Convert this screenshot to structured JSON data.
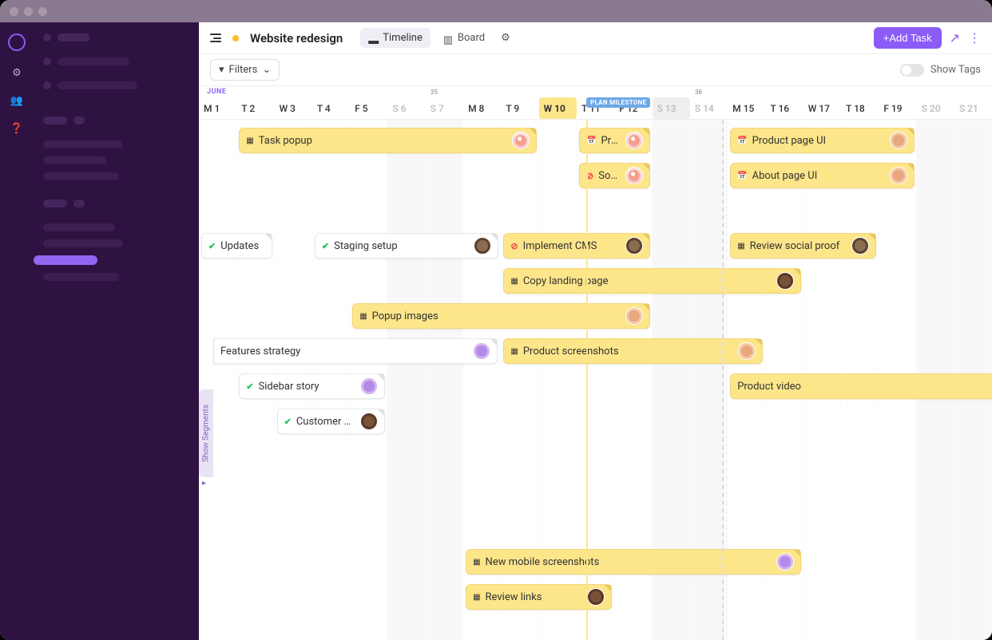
{
  "project": {
    "name": "Website redesign"
  },
  "views": {
    "timeline": "Timeline",
    "board": "Board"
  },
  "actions": {
    "add_task": "+Add Task",
    "filters": "Filters",
    "show_tags": "Show Tags"
  },
  "month": "JUNE",
  "milestone_label": "PLAN MILESTONE",
  "segments_label": "Show Segments",
  "days": [
    {
      "l": "M 1"
    },
    {
      "l": "T 2"
    },
    {
      "l": "W 3"
    },
    {
      "l": "T 4"
    },
    {
      "l": "F 5"
    },
    {
      "l": "S 6",
      "w": true
    },
    {
      "l": "S 7",
      "w": true,
      "wk": "35"
    },
    {
      "l": "M 8"
    },
    {
      "l": "T 9"
    },
    {
      "l": "W 10",
      "today": true
    },
    {
      "l": "T 11"
    },
    {
      "l": "F 12"
    },
    {
      "l": "S 13",
      "w": true,
      "gray": true
    },
    {
      "l": "S 14",
      "w": true,
      "wk": "36"
    },
    {
      "l": "M 15"
    },
    {
      "l": "T 16"
    },
    {
      "l": "W 17"
    },
    {
      "l": "T 18"
    },
    {
      "l": "F 19"
    },
    {
      "l": "S 20",
      "w": true
    },
    {
      "l": "S 21",
      "w": true
    }
  ],
  "tasks": [
    {
      "name": "Task popup",
      "row": 0,
      "start": 1,
      "span": 8,
      "style": "yellow",
      "icon": "progress",
      "av": "av1"
    },
    {
      "name": "Product",
      "row": 0,
      "start": 10,
      "span": 2,
      "style": "yellow",
      "icon": "cal",
      "av": "av1"
    },
    {
      "name": "Product page UI",
      "row": 0,
      "start": 14,
      "span": 5,
      "style": "yellow",
      "icon": "cal",
      "av": "av3"
    },
    {
      "name": "Social",
      "row": 1,
      "start": 10,
      "span": 2,
      "style": "yellow",
      "icon": "block",
      "av": "av1"
    },
    {
      "name": "About page UI",
      "row": 1,
      "start": 14,
      "span": 5,
      "style": "yellow",
      "icon": "cal",
      "av": "av3"
    },
    {
      "name": "Updates",
      "row": 3,
      "start": 0,
      "span": 2,
      "style": "white",
      "icon": "check"
    },
    {
      "name": "Staging setup",
      "row": 3,
      "start": 3,
      "span": 5,
      "style": "white",
      "icon": "check",
      "av": "av2"
    },
    {
      "name": "Implement CMS",
      "row": 3,
      "start": 8,
      "span": 4,
      "style": "yellow",
      "icon": "block",
      "av": "av2"
    },
    {
      "name": "Review social proof",
      "row": 3,
      "start": 14,
      "span": 4,
      "style": "yellow",
      "icon": "progress",
      "av": "av2"
    },
    {
      "name": "Copy landing page",
      "row": 4,
      "start": 8,
      "span": 8,
      "style": "yellow",
      "icon": "progress",
      "av": "av5"
    },
    {
      "name": "Popup images",
      "row": 5,
      "start": 4,
      "span": 8,
      "style": "yellow",
      "icon": "progress",
      "av": "av3"
    },
    {
      "name": "Features strategy",
      "row": 6,
      "start": 0,
      "span": 8,
      "style": "white",
      "icon": "",
      "av": "av4",
      "leftcut": true
    },
    {
      "name": "Product screenshots",
      "row": 6,
      "start": 8,
      "span": 7,
      "style": "yellow",
      "icon": "progress",
      "av": "av3"
    },
    {
      "name": "Product video",
      "row": 7,
      "start": 14,
      "span": 7,
      "style": "yellow",
      "icon": "",
      "rightcut": true
    },
    {
      "name": "Sidebar story",
      "row": 7,
      "start": 1,
      "span": 4,
      "style": "white",
      "icon": "check",
      "av": "av4"
    },
    {
      "name": "Customer stories",
      "row": 8,
      "start": 2,
      "span": 3,
      "style": "white",
      "icon": "check",
      "av": "av5"
    },
    {
      "name": "New mobile screenshots",
      "row": 12,
      "start": 7,
      "span": 9,
      "style": "yellow",
      "icon": "progress",
      "av": "av4"
    },
    {
      "name": "Review links",
      "row": 13,
      "start": 7,
      "span": 4,
      "style": "yellow",
      "icon": "progress",
      "av": "av5"
    }
  ]
}
